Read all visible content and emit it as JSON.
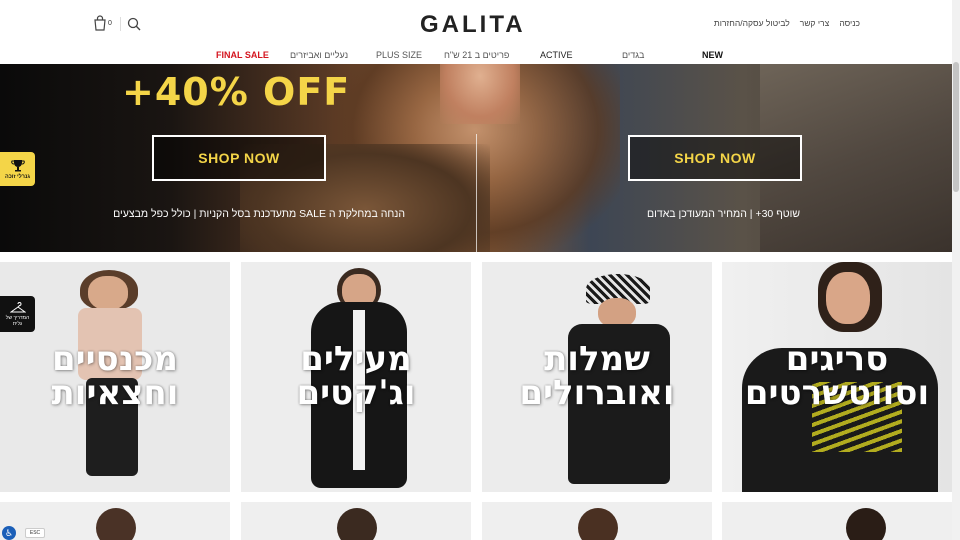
{
  "header": {
    "logo": "GALITA",
    "util_links": [
      "כניסה",
      "צרי קשר",
      "לביטול עסקה/החזרות"
    ],
    "cart_count": "0"
  },
  "nav": {
    "items": [
      {
        "label": "NEW",
        "style": "bold"
      },
      {
        "label": "בגדים",
        "style": "normal"
      },
      {
        "label": "ACTIVE",
        "style": "normal-dark"
      },
      {
        "label": "פריטים ב 21 ש\"ח",
        "style": "normal"
      },
      {
        "label": "PLUS SIZE",
        "style": "normal"
      },
      {
        "label": "נעליים ואביזרים",
        "style": "normal"
      },
      {
        "label": "FINAL SALE",
        "style": "red"
      }
    ]
  },
  "hero": {
    "promo": "+40% OFF",
    "left_button": "SHOP NOW",
    "right_button": "SHOP NOW",
    "left_text": "הנחה במחלקת ה SALE מתעדכנת בסל הקניות | כולל כפל מבצעים",
    "right_text": "שוטף 30+ | המחיר המעודכן באדום"
  },
  "badges": {
    "vip": "גנרלי זוכה",
    "guide_line1": "המדריך של",
    "guide_line2": "גלית"
  },
  "tiles": [
    {
      "line1": "מכנסיים",
      "line2": "וחצאיות"
    },
    {
      "line1": "מעילים",
      "line2": "וג'קטים"
    },
    {
      "line1": "שמלות",
      "line2": "ואוברולים"
    },
    {
      "line1": "סריגים",
      "line2": "וסווטשרטים"
    }
  ],
  "accessibility": {
    "esc": "ESC"
  },
  "colors": {
    "accent_yellow": "#f4d548",
    "sale_red": "#d4151f"
  }
}
